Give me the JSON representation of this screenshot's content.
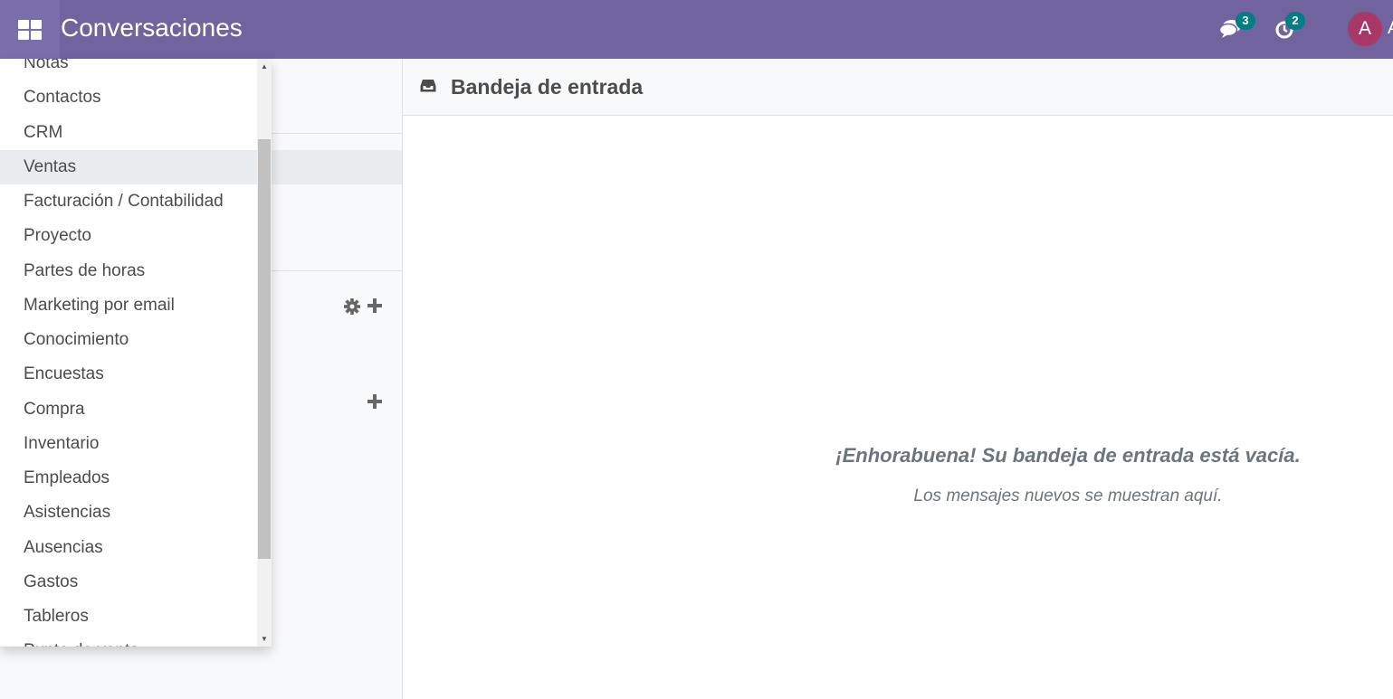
{
  "navbar": {
    "app_title": "Conversaciones",
    "messages_badge": "3",
    "activities_badge": "2",
    "avatar_initial": "A",
    "username_clipped": "A",
    "color": "#71639e"
  },
  "apps_menu": {
    "items": [
      {
        "label": "Notas"
      },
      {
        "label": "Contactos"
      },
      {
        "label": "CRM"
      },
      {
        "label": "Ventas"
      },
      {
        "label": "Facturación / Contabilidad"
      },
      {
        "label": "Proyecto"
      },
      {
        "label": "Partes de horas"
      },
      {
        "label": "Marketing por email"
      },
      {
        "label": "Conocimiento"
      },
      {
        "label": "Encuestas"
      },
      {
        "label": "Compra"
      },
      {
        "label": "Inventario"
      },
      {
        "label": "Empleados"
      },
      {
        "label": "Asistencias"
      },
      {
        "label": "Ausencias"
      },
      {
        "label": "Gastos"
      },
      {
        "label": "Tableros"
      },
      {
        "label": "Punto de venta"
      }
    ],
    "highlighted": "Ventas"
  },
  "main": {
    "title": "Bandeja de entrada",
    "empty_title": "¡Enhorabuena! Su bandeja de entrada está vacía.",
    "empty_subtitle": "Los mensajes nuevos se muestran aquí."
  },
  "icons": {
    "apps": "grid-icon",
    "messages": "comments-icon",
    "activities": "clock-icon",
    "inbox": "inbox-icon",
    "channels_settings": "gear-icon",
    "add": "plus-icon"
  }
}
